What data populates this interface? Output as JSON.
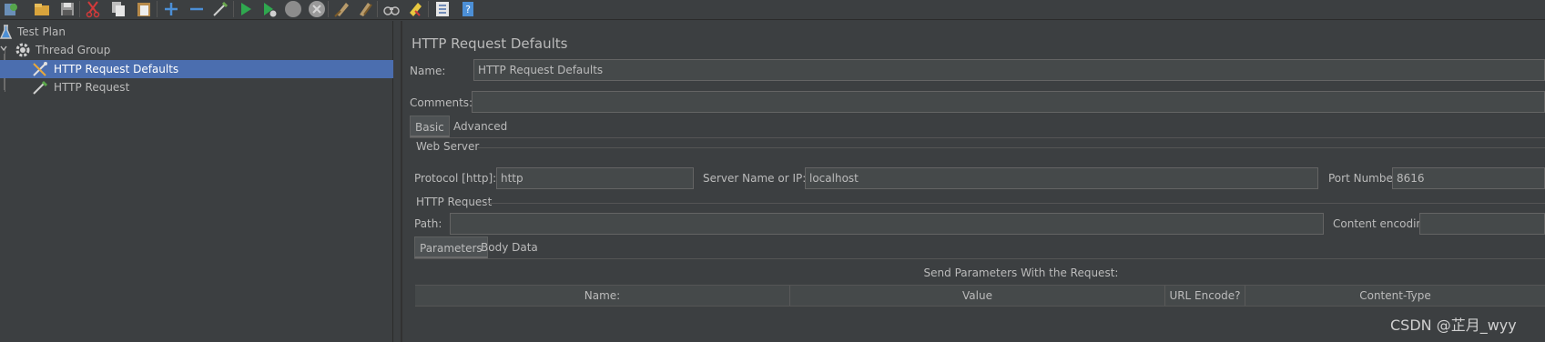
{
  "toolbar": {
    "icons": [
      "templates-icon",
      "open-icon",
      "save-icon",
      "cut-icon",
      "copy-icon",
      "paste-icon",
      "expand-icon",
      "collapse-icon",
      "toggle-icon",
      "start-icon",
      "start-no-pauses-icon",
      "stop-icon",
      "shutdown-icon",
      "clear-icon",
      "clear-all-icon",
      "search-icon",
      "reset-search-icon",
      "function-helper-icon",
      "help-icon"
    ]
  },
  "tree": {
    "items": [
      {
        "label": "Test Plan"
      },
      {
        "label": "Thread Group"
      },
      {
        "label": "HTTP Request Defaults"
      },
      {
        "label": "HTTP Request"
      }
    ]
  },
  "main": {
    "title": "HTTP Request Defaults",
    "name_label": "Name:",
    "name_value": "HTTP Request Defaults",
    "comments_label": "Comments:",
    "comments_value": "",
    "tabs": [
      {
        "label": "Basic"
      },
      {
        "label": "Advanced"
      }
    ],
    "web_server": {
      "group_label": "Web Server",
      "protocol_label": "Protocol [http]:",
      "protocol_value": "http",
      "server_label": "Server Name or IP:",
      "server_value": "localhost",
      "port_label": "Port Number:",
      "port_value": "8616"
    },
    "http_request": {
      "group_label": "HTTP Request",
      "path_label": "Path:",
      "path_value": "",
      "encoding_label": "Content encoding:",
      "encoding_value": ""
    },
    "sub_tabs": [
      {
        "label": "Parameters"
      },
      {
        "label": "Body Data"
      }
    ],
    "params_caption": "Send Parameters With the Request:",
    "columns": [
      "Name:",
      "Value",
      "URL Encode?",
      "Content-Type"
    ]
  },
  "watermark": "CSDN @芷月_wyy",
  "colors": {
    "background": "#3c3f41",
    "selection": "#4b6eaf",
    "field": "#45494a"
  }
}
